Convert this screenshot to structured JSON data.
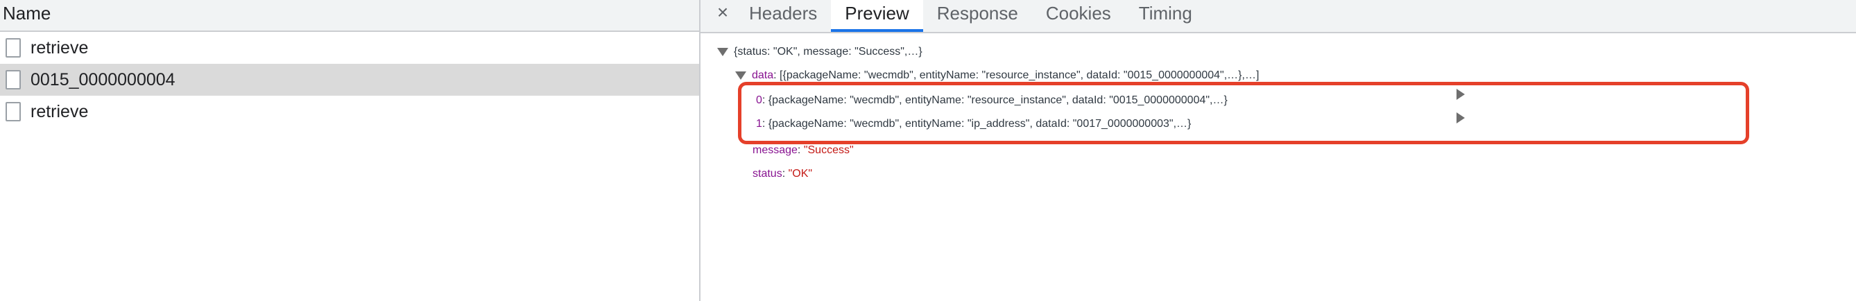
{
  "network": {
    "column_header": "Name",
    "requests": [
      {
        "name": "retrieve"
      },
      {
        "name": "0015_0000000004"
      },
      {
        "name": "retrieve"
      }
    ]
  },
  "preview": {
    "close_symbol": "×",
    "tabs": [
      "Headers",
      "Preview",
      "Response",
      "Cookies",
      "Timing"
    ],
    "active_tab": "Preview",
    "root_summary": "{status: \"OK\", message: \"Success\",…}",
    "data_key": "data",
    "data_summary": "[{packageName: \"wecmdb\", entityName: \"resource_instance\", dataId: \"0015_0000000004\",…},…]",
    "items": [
      {
        "index": "0",
        "summary": "{packageName: \"wecmdb\", entityName: \"resource_instance\", dataId: \"0015_0000000004\",…}"
      },
      {
        "index": "1",
        "summary": "{packageName: \"wecmdb\", entityName: \"ip_address\", dataId: \"0017_0000000003\",…}"
      }
    ],
    "message_key": "message",
    "message_value": "\"Success\"",
    "status_key": "status",
    "status_value": "\"OK\""
  },
  "colors": {
    "highlight_border": "#e5402a",
    "active_tab_underline": "#1a73e8",
    "json_key": "#881391",
    "json_string": "#c41a16"
  }
}
